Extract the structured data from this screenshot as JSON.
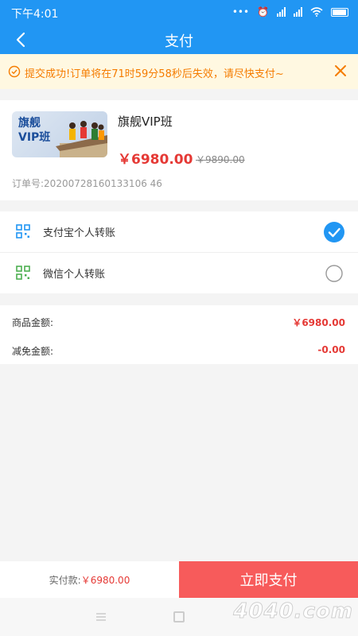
{
  "status": {
    "time": "下午4:01"
  },
  "nav": {
    "title": "支付"
  },
  "notice": {
    "text": "提交成功!订单将在71时59分58秒后失效，请尽快支付~"
  },
  "product": {
    "thumb_text": "旗舰\nVIP班",
    "name": "旗舰VIP班",
    "price": "￥6980.00",
    "original_price": "￥9890.00",
    "order_no": "订单号:20200728160133106 46"
  },
  "payments": [
    {
      "label": "支付宝个人转账",
      "icon": "qr-icon",
      "color": "#2196f3",
      "selected": true
    },
    {
      "label": "微信个人转账",
      "icon": "qr-icon",
      "color": "#4caf50",
      "selected": false
    }
  ],
  "amounts": [
    {
      "label": "商品金额:",
      "value": "￥6980.00"
    },
    {
      "label": "减免金额:",
      "value": "-0.00"
    }
  ],
  "bottom": {
    "total_label": "实付款:",
    "total_amount": "￥6980.00",
    "pay_button": "立即支付"
  },
  "watermark": "4040.com",
  "colors": {
    "primary": "#2196f3",
    "accent": "#e53935",
    "notice_bg": "#fff8e1",
    "notice_text": "#f57c00",
    "pay_button": "#f75b5b"
  }
}
